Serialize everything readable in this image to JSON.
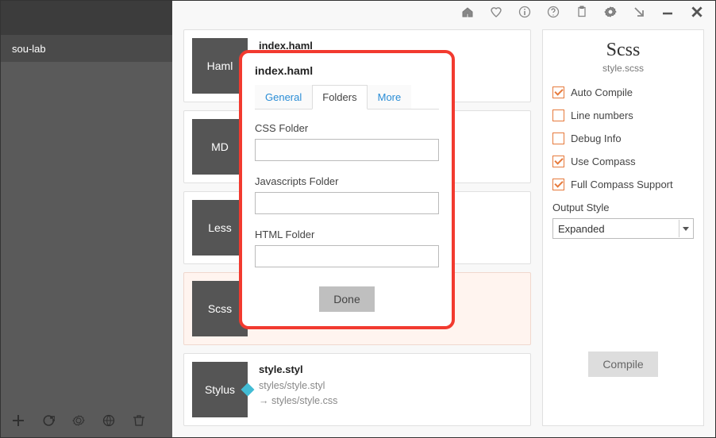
{
  "sidebar": {
    "project": "sou-lab",
    "footer_icons": [
      "plus",
      "refresh",
      "gear",
      "globe",
      "trash"
    ]
  },
  "toolbar_icons": [
    "home",
    "heart",
    "info",
    "help",
    "clipboard",
    "gear",
    "arrow-dr",
    "minimize",
    "close"
  ],
  "files": [
    {
      "badge": "Haml",
      "accent": "#7aa2c9",
      "title": "index.haml",
      "sub1": "",
      "sub2": "",
      "selected": false
    },
    {
      "badge": "MD",
      "accent": "#f0b23c",
      "title": "",
      "sub1": "",
      "sub2": "",
      "selected": false
    },
    {
      "badge": "Less",
      "accent": "#e07030",
      "title": "",
      "sub1": "",
      "sub2": "",
      "selected": false
    },
    {
      "badge": "Scss",
      "accent": "#d94fa0",
      "title": "",
      "sub1": "",
      "sub2": "",
      "selected": true
    },
    {
      "badge": "Stylus",
      "accent": "#42bcd4",
      "title": "style.styl",
      "sub1": "styles/style.styl",
      "sub2": "→ styles/style.css",
      "selected": false
    }
  ],
  "rightpanel": {
    "heading": "Scss",
    "subtitle": "style.scss",
    "checks": [
      {
        "label": "Auto Compile",
        "checked": true
      },
      {
        "label": "Line numbers",
        "checked": false
      },
      {
        "label": "Debug Info",
        "checked": false
      },
      {
        "label": "Use Compass",
        "checked": true
      },
      {
        "label": "Full Compass Support",
        "checked": true
      }
    ],
    "output_style_label": "Output Style",
    "output_style_value": "Expanded",
    "compile_label": "Compile"
  },
  "modal": {
    "title": "index.haml",
    "tabs": [
      "General",
      "Folders",
      "More"
    ],
    "active_tab": "Folders",
    "fields": [
      {
        "label": "CSS Folder",
        "value": ""
      },
      {
        "label": "Javascripts Folder",
        "value": ""
      },
      {
        "label": "HTML Folder",
        "value": ""
      }
    ],
    "done_label": "Done"
  }
}
